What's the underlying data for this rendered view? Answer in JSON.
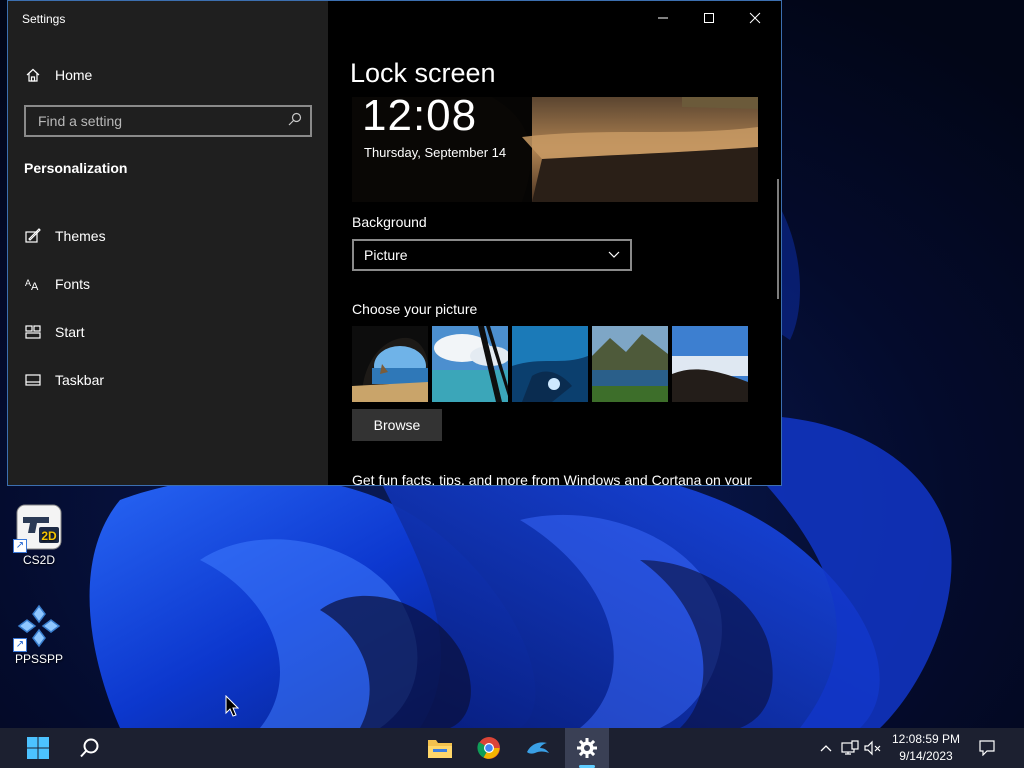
{
  "window": {
    "title": "Settings",
    "home_label": "Home",
    "search_placeholder": "Find a setting",
    "section_heading": "Personalization",
    "nav_items": [
      {
        "label": "Themes",
        "icon": "themes-icon"
      },
      {
        "label": "Fonts",
        "icon": "fonts-icon"
      },
      {
        "label": "Start",
        "icon": "start-icon"
      },
      {
        "label": "Taskbar",
        "icon": "taskbar-icon"
      }
    ]
  },
  "lock_screen": {
    "title": "Lock screen",
    "preview_time": "12:08",
    "preview_date": "Thursday, September 14",
    "background_label": "Background",
    "background_value": "Picture",
    "choose_picture_label": "Choose your picture",
    "browse_label": "Browse",
    "fun_facts_text": "Get fun facts, tips, and more from Windows and Cortana on your"
  },
  "desktop": {
    "icons": [
      {
        "label": "CS2D",
        "badge": "2D"
      },
      {
        "label": "PPSSPP"
      }
    ]
  },
  "taskbar": {
    "clock_time": "12:08:59 PM",
    "clock_date": "9/14/2023",
    "apps": [
      "start-button",
      "search-button",
      "file-explorer",
      "chrome",
      "dolphin",
      "settings"
    ]
  },
  "colors": {
    "accent": "#60cdff",
    "sidebar_bg": "#1f1f1f",
    "content_bg": "#000000",
    "taskbar_bg": "#1c2030"
  }
}
